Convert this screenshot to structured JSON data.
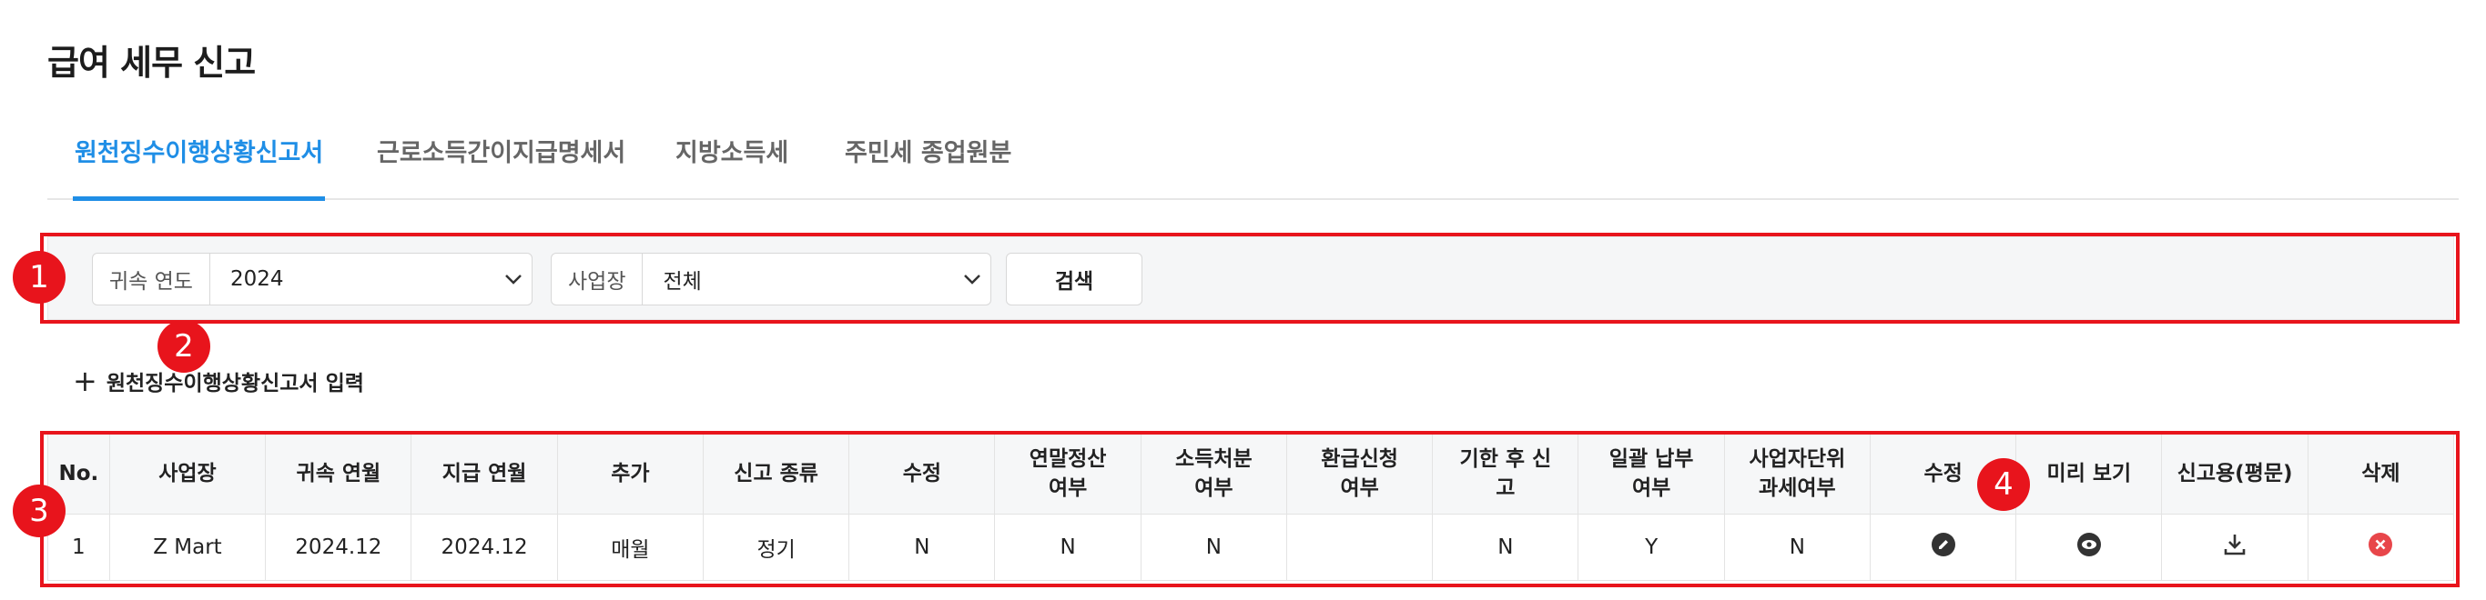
{
  "page": {
    "title": "급여 세무 신고"
  },
  "tabs": [
    {
      "label": "원천징수이행상황신고서",
      "active": true
    },
    {
      "label": "근로소득간이지급명세서",
      "active": false
    },
    {
      "label": "지방소득세",
      "active": false
    },
    {
      "label": "주민세 종업원분",
      "active": false
    }
  ],
  "filters": {
    "year": {
      "label": "귀속 연도",
      "value": "2024"
    },
    "site": {
      "label": "사업장",
      "value": "전체"
    },
    "search_label": "검색"
  },
  "add_button": {
    "icon": "plus-icon",
    "label": "원천징수이행상황신고서 입력"
  },
  "table": {
    "headers": [
      "No.",
      "사업장",
      "귀속 연월",
      "지급 연월",
      "추가",
      "신고 종류",
      "수정",
      "연말정산\n여부",
      "소득처분\n여부",
      "환급신청\n여부",
      "기한 후 신\n고",
      "일괄 납부\n여부",
      "사업자단위\n과세여부",
      "수정",
      "미리 보기",
      "신고용(평문)",
      "삭제"
    ],
    "rows": [
      {
        "cells": [
          "1",
          "Z Mart",
          "2024.12",
          "2024.12",
          "매월",
          "정기",
          "N",
          "N",
          "N",
          "",
          "N",
          "Y",
          "N"
        ],
        "actions": {
          "edit": "pencil-icon",
          "preview": "eye-icon",
          "download": "download-icon",
          "delete": "delete-icon"
        }
      }
    ]
  },
  "annotations": [
    "1",
    "2",
    "3",
    "4"
  ],
  "colors": {
    "accent": "#1f8ee6",
    "highlight": "#e8141c",
    "delete": "#e8464a"
  }
}
